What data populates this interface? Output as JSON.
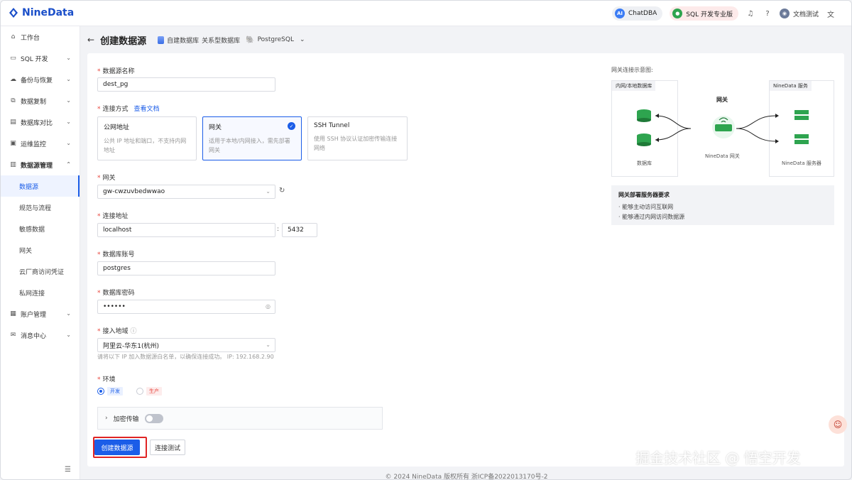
{
  "header": {
    "brand": "NineData",
    "chat_label": "ChatDBA",
    "chat_badge": "AI",
    "sql_label": "SQL 开发专业版",
    "user_name": "文档测试",
    "icons": [
      "bell-icon",
      "help-icon",
      "avatar",
      "language-icon"
    ]
  },
  "sidebar": {
    "items": [
      {
        "label": "工作台",
        "icon": "home-icon",
        "chevron": false
      },
      {
        "label": "SQL 开发",
        "icon": "sql-icon",
        "chevron": true
      },
      {
        "label": "备份与恢复",
        "icon": "backup-icon",
        "chevron": true
      },
      {
        "label": "数据复制",
        "icon": "copy-icon",
        "chevron": true
      },
      {
        "label": "数据库对比",
        "icon": "compare-icon",
        "chevron": true
      },
      {
        "label": "运维监控",
        "icon": "monitor-icon",
        "chevron": true
      },
      {
        "label": "数据源管理",
        "icon": "datasource-icon",
        "chevron": true
      }
    ],
    "sub_items": [
      "数据源",
      "规范与流程",
      "敏感数据",
      "网关",
      "云厂商访问凭证",
      "私网连接"
    ],
    "active_sub": "数据源",
    "bottom_items": [
      {
        "label": "账户管理",
        "icon": "account-icon",
        "chevron": true
      },
      {
        "label": "消息中心",
        "icon": "message-icon",
        "chevron": true
      }
    ]
  },
  "topbar": {
    "title": "创建数据源",
    "crumb_type": "自建数据库",
    "crumb_category": "关系型数据库",
    "crumb_engine": "PostgreSQL"
  },
  "form": {
    "name_label": "数据源名称",
    "name_value": "dest_pg",
    "conn_label": "连接方式",
    "conn_doc_link": "查看文档",
    "conn_options": [
      {
        "title": "公网地址",
        "desc": "公共 IP 地址和端口，不支持内网地址",
        "selected": false
      },
      {
        "title": "网关",
        "desc": "适用于本地/内网接入，需先部署网关",
        "selected": true
      },
      {
        "title": "SSH Tunnel",
        "desc": "使用 SSH 协议认证加密传输连接网络",
        "selected": false
      }
    ],
    "gateway_label": "网关",
    "gateway_value": "gw-cwzuvbedwwao",
    "address_label": "连接地址",
    "address_value": "localhost",
    "port_sep": ":",
    "port_value": "5432",
    "account_label": "数据库账号",
    "account_value": "postgres",
    "password_label": "数据库密码",
    "password_value": "••••••",
    "region_label": "接入地域",
    "region_value": "阿里云-华东1(杭州)",
    "region_hint": "请将以下 IP 加入数据源白名单，以确保连接成功。 IP: 192.168.2.90",
    "env_label": "环境",
    "env_options": [
      {
        "label": "开发",
        "selected": true
      },
      {
        "label": "生产",
        "selected": false
      }
    ],
    "encrypt_label": "加密传输",
    "encrypt_on": false,
    "create_button": "创建数据源",
    "test_button": "连接测试"
  },
  "diagram": {
    "title": "网关连接示意图:",
    "left_box": "内网/本地数据库",
    "right_box": "NineData 服务",
    "gateway_title": "网关",
    "db_caption": "数据库",
    "gateway_caption": "NineData 网关",
    "server_caption": "NineData 服务器"
  },
  "requirements": {
    "title": "网关部署服务器要求",
    "lines": [
      "· 能够主动访问互联网",
      "· 能够通过内网访问数据源"
    ]
  },
  "footer": {
    "text": "© 2024 NineData 版权所有    浙ICP备2022013170号-2"
  },
  "watermark": "掘金技术社区 @ 悟空开发",
  "colors": {
    "primary": "#1b5de8",
    "danger": "#e8453c",
    "db_green": "#2ea44f"
  }
}
